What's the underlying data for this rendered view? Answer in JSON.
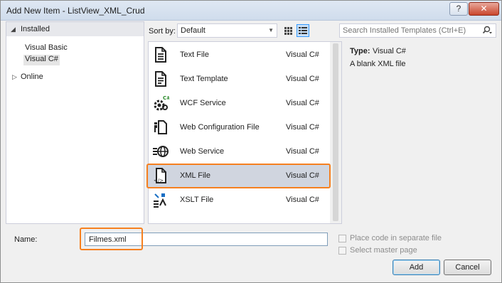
{
  "window": {
    "title": "Add New Item - ListView_XML_Crud",
    "help_label": "?",
    "close_label": "✕"
  },
  "tree": {
    "installed_label": "Installed",
    "languages": [
      "Visual Basic",
      "Visual C#"
    ],
    "selected_language": "Visual C#",
    "online_label": "Online"
  },
  "toolbar": {
    "sort_by_label": "Sort by:",
    "sort_value": "Default",
    "search_placeholder": "Search Installed Templates (Ctrl+E)"
  },
  "templates": [
    {
      "name": "Text File",
      "lang": "Visual C#",
      "icon": "text-file-icon"
    },
    {
      "name": "Text Template",
      "lang": "Visual C#",
      "icon": "text-template-icon"
    },
    {
      "name": "WCF Service",
      "lang": "Visual C#",
      "icon": "wcf-service-icon"
    },
    {
      "name": "Web Configuration File",
      "lang": "Visual C#",
      "icon": "web-config-icon"
    },
    {
      "name": "Web Service",
      "lang": "Visual C#",
      "icon": "web-service-icon"
    },
    {
      "name": "XML File",
      "lang": "Visual C#",
      "icon": "xml-file-icon",
      "selected": true
    },
    {
      "name": "XSLT File",
      "lang": "Visual C#",
      "icon": "xslt-file-icon"
    }
  ],
  "info": {
    "type_label": "Type:",
    "type_value": "Visual C#",
    "description": "A blank XML file"
  },
  "form": {
    "name_label": "Name:",
    "name_value": "Filmes.xml",
    "separate_file_label": "Place code in separate file",
    "master_page_label": "Select master page"
  },
  "buttons": {
    "add_label": "Add",
    "cancel_label": "Cancel"
  },
  "colors": {
    "highlight": "#f6801f",
    "selected_row": "#d0d5df",
    "accent": "#3399ff"
  }
}
